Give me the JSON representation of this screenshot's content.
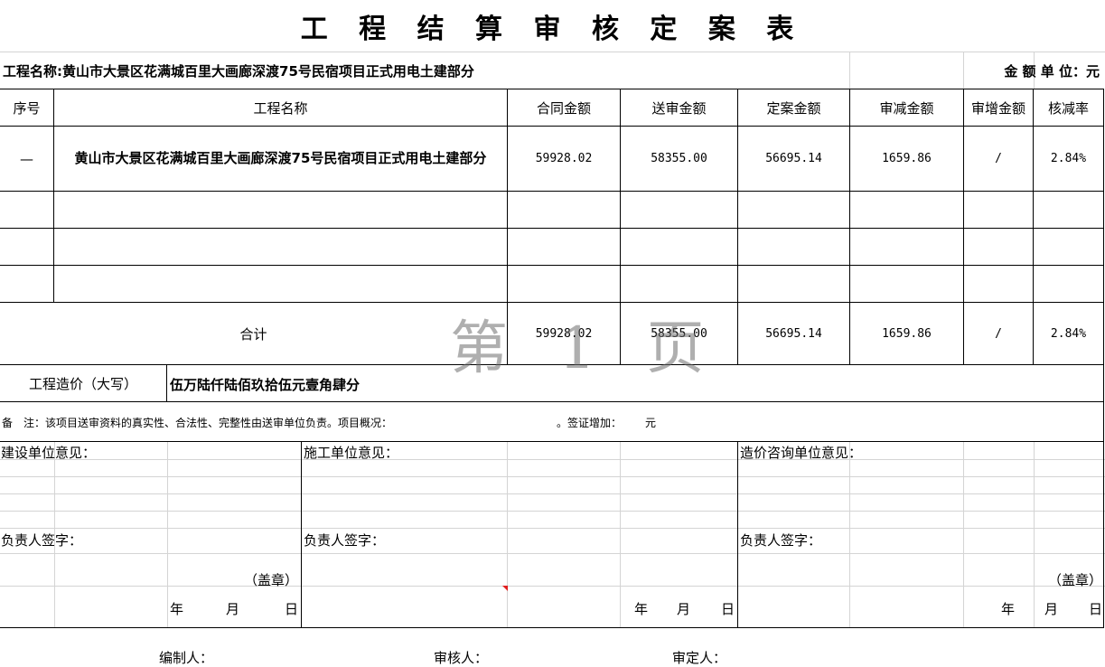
{
  "title": "工 程 结 算 审 核 定 案 表",
  "project_line": {
    "label": "工程名称:",
    "value": "黄山市大景区花满城百里大画廊深渡75号民宿项目正式用电土建部分",
    "unit": "金 额 单 位：元"
  },
  "table": {
    "headers": [
      "序号",
      "工程名称",
      "合同金额",
      "送审金额",
      "定案金额",
      "审减金额",
      "审增金额",
      "核减率"
    ],
    "rows": [
      {
        "index": "—",
        "name": "黄山市大景区花满城百里大画廊深渡75号民宿项目正式用电土建部分",
        "contract": "59928.02",
        "submitted": "58355.00",
        "final": "56695.14",
        "reduced": "1659.86",
        "increased": "/",
        "rate": "2.84%"
      }
    ],
    "total": {
      "label": "合计",
      "contract": "59928.02",
      "submitted": "58355.00",
      "final": "56695.14",
      "reduced": "1659.86",
      "increased": "/",
      "rate": "2.84%"
    }
  },
  "watermark": "第 1 页",
  "cost_in_words": {
    "label": "工程造价（大写）",
    "value": "伍万陆仟陆佰玖拾伍元壹角肆分"
  },
  "remark": {
    "prefix": "备　注：该项目送审资料的真实性、合法性、完整性由送审单位负责。项目概况：",
    "visa_label": "。签证增加：",
    "visa_unit": "元"
  },
  "opinions": [
    {
      "title": "建设单位意见：",
      "sign": "负责人签字：",
      "seal": "（盖章）",
      "year": "年",
      "month": "月",
      "day": "日"
    },
    {
      "title": "施工单位意见：",
      "sign": "负责人签字：",
      "seal": "",
      "year": "年",
      "month": "月",
      "day": "日"
    },
    {
      "title": "造价咨询单位意见：",
      "sign": "负责人签字：",
      "seal": "（盖章）",
      "year": "年",
      "month": "月",
      "day": "日"
    }
  ],
  "footer": {
    "compiler": "编制人：",
    "reviewer": "审核人：",
    "approver": "审定人："
  }
}
